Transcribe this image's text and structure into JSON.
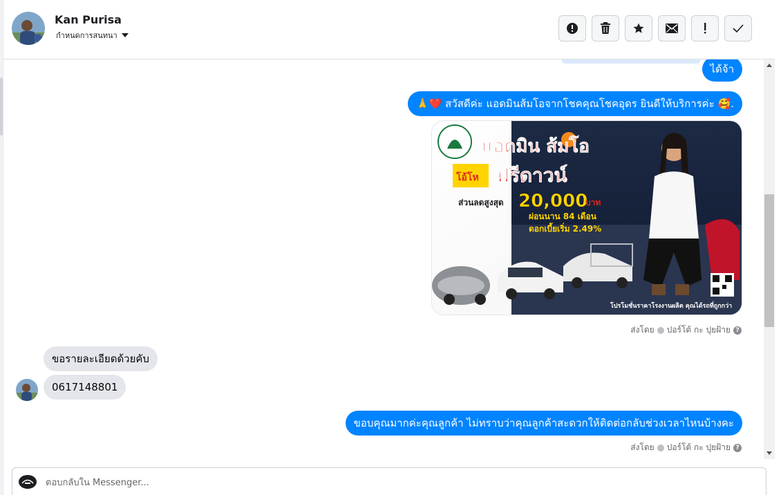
{
  "header": {
    "user_name": "Kan Purisa",
    "assign_label": "กำหนดการสนทนา"
  },
  "toolbar": {
    "buttons": [
      {
        "name": "spam-button",
        "icon": "alert-circle-icon"
      },
      {
        "name": "delete-button",
        "icon": "trash-icon"
      },
      {
        "name": "star-button",
        "icon": "star-icon"
      },
      {
        "name": "mark-unread-button",
        "icon": "envelope-icon"
      },
      {
        "name": "follow-up-button",
        "icon": "exclamation-icon"
      },
      {
        "name": "mark-done-button",
        "icon": "check-icon"
      }
    ]
  },
  "messages": {
    "m1": {
      "direction": "outgoing",
      "text": "ได้จ้า"
    },
    "m2": {
      "direction": "outgoing",
      "text": "🙏❤️ สวัสดีค่ะ แอดมินส้มโอจากโชคคุณโชคอุดร ยินดีให้บริการค่ะ 🥰."
    },
    "image": {
      "brand": "แอดมิน ส้มโอ",
      "promo_tag": "โอ้โห",
      "headline": "ฟรีดาวน์",
      "discount_label": "ส่วนลดสูงสุด",
      "discount_amount": "20,000",
      "discount_unit": "บาท",
      "installment": "ผ่อนนาน 84 เดือน",
      "interest": "ดอกเบี้ยเริ่ม 2.49%",
      "footer": "โปรโมชั่นราคาโรงงานผลิต คุณได้รถที่ถูกกว่า"
    },
    "sent_by_1": {
      "prefix": "ส่งโดย",
      "agent": "ปอร์โต้ กะ ปุยฝ้าย"
    },
    "m3": {
      "direction": "incoming",
      "text": "ขอรายละเอียดด้วยคับ"
    },
    "m4": {
      "direction": "incoming",
      "text": "0617148801"
    },
    "m5": {
      "direction": "outgoing",
      "text": "ขอบคุณมากค่ะคุณลูกค้า ไม่ทราบว่าคุณลูกค้าสะดวกให้ติดต่อกลับช่วงเวลาไหนบ้างคะ"
    },
    "sent_by_2": {
      "prefix": "ส่งโดย",
      "agent": "ปอร์โต้ กะ ปุยฝ้าย"
    }
  },
  "composer": {
    "placeholder": "ตอบกลับใน Messenger..."
  },
  "colors": {
    "outgoing_bubble": "#0084ff",
    "incoming_bubble": "#e4e6eb"
  }
}
